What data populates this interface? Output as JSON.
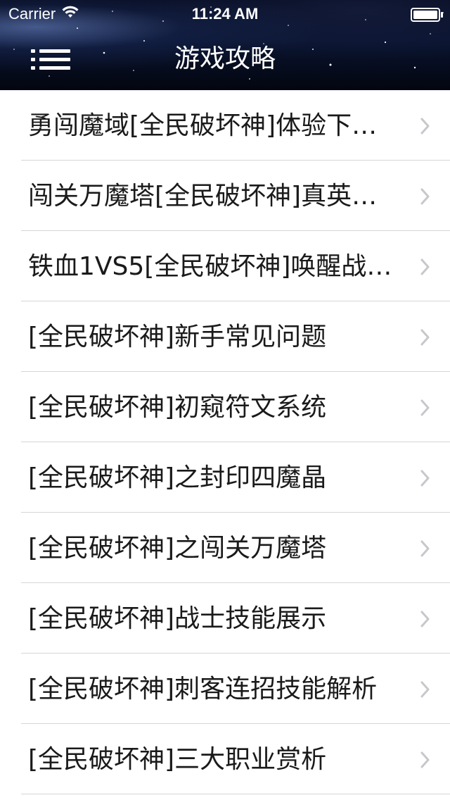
{
  "status_bar": {
    "carrier": "Carrier",
    "time": "11:24 AM",
    "wifi_icon": "wifi-icon",
    "battery_icon": "battery-full-icon"
  },
  "nav": {
    "title": "游戏攻略",
    "menu_icon": "hamburger-menu-icon"
  },
  "list": {
    "items": [
      {
        "label": "勇闯魔域[全民破坏神]体验下…"
      },
      {
        "label": "闯关万魔塔[全民破坏神]真英…"
      },
      {
        "label": "铁血1VS5[全民破坏神]唤醒战…"
      },
      {
        "label": "[全民破坏神]新手常见问题"
      },
      {
        "label": "[全民破坏神]初窥符文系统"
      },
      {
        "label": "[全民破坏神]之封印四魔晶"
      },
      {
        "label": "[全民破坏神]之闯关万魔塔"
      },
      {
        "label": "[全民破坏神]战士技能展示"
      },
      {
        "label": "[全民破坏神]刺客连招技能解析"
      },
      {
        "label": "[全民破坏神]三大职业赏析"
      }
    ],
    "chevron_icon": "chevron-right-icon"
  },
  "colors": {
    "header_background": "#0a1430",
    "text": "#1a1a1a",
    "chevron": "#c7c7cc",
    "separator": "#d6d6d9"
  }
}
